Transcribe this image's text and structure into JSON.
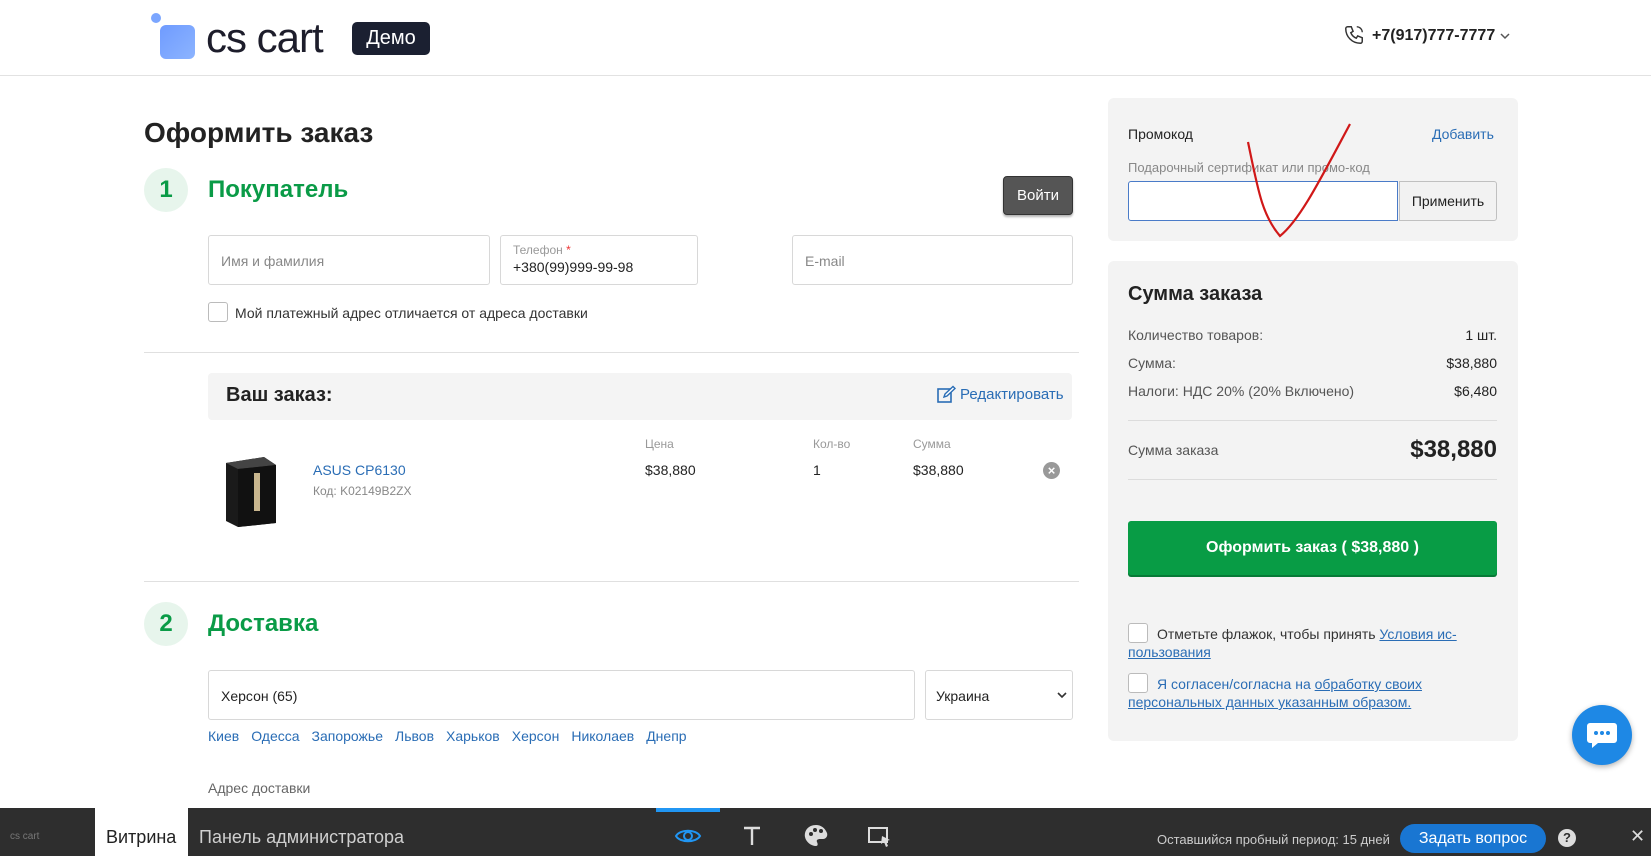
{
  "header": {
    "logo_text": "cs cart",
    "demo_badge": "Демо",
    "phone": "+7(917)777-7777"
  },
  "page_title": "Оформить заказ",
  "buyer": {
    "step": "1",
    "title": "Покупатель",
    "login_label": "Войти",
    "name_placeholder": "Имя и фамилия",
    "phone_label": "Телефон",
    "phone_value": "+380(99)999-99-98",
    "email_placeholder": "E-mail",
    "billing_diff_label": "Мой платежный адрес отличается от адреса доставки"
  },
  "order": {
    "title": "Ваш заказ:",
    "edit_label": "Редактировать",
    "columns": {
      "price": "Цена",
      "qty": "Кол-во",
      "sum": "Сумма"
    },
    "items": [
      {
        "name": "ASUS CP6130",
        "code": "Код: K02149B2ZX",
        "price": "$38,880",
        "qty": "1",
        "sum": "$38,880"
      }
    ]
  },
  "delivery": {
    "step": "2",
    "title": "Доставка",
    "city_value": "Херсон (65)",
    "country_value": "Украина",
    "cities": [
      "Киев",
      "Одесса",
      "Запорожье",
      "Львов",
      "Харьков",
      "Херсон",
      "Николаев",
      "Днепр"
    ],
    "address_label": "Адрес доставки"
  },
  "promo": {
    "label": "Промокод",
    "add_label": "Добавить",
    "hint": "Подарочный сертификат или промо-код",
    "apply_label": "Применить"
  },
  "summary": {
    "title": "Сумма заказа",
    "rows": [
      {
        "label": "Количество товаров:",
        "value": "1 шт."
      },
      {
        "label": "Сумма:",
        "value": "$38,880"
      },
      {
        "label": "Налоги: НДС 20% (20% Включено)",
        "value": "$6,480"
      }
    ],
    "total_label": "Сумма заказа",
    "total_value": "$38,880",
    "place_order_label": "Оформить заказ ( $38,880 )",
    "terms_text": "Отметьте флажок, чтобы принять ",
    "terms_link": "Условия ис-пользования",
    "consent_text": "Я согласен/согласна на ",
    "consent_link": "обработку своих персональных данных указанным образом."
  },
  "bottom_bar": {
    "mini_logo": "cs cart",
    "storefront": "Витрина",
    "admin_panel": "Панель администратора",
    "trial": "Оставшийся пробный период: 15 дней",
    "ask_label": "Задать вопрос",
    "help": "?",
    "close": "✕"
  },
  "colors": {
    "accent_green": "#0a9b47",
    "link_blue": "#2a6db5",
    "button_green": "#089c45",
    "bar_dark": "#2e2e2e",
    "ask_blue": "#1976d2"
  },
  "icons": [
    "phone-icon",
    "chevron-down-icon",
    "edit-icon",
    "remove-icon",
    "chat-icon",
    "eye-icon",
    "text-icon",
    "palette-icon",
    "layout-icon",
    "help-icon",
    "close-icon"
  ]
}
